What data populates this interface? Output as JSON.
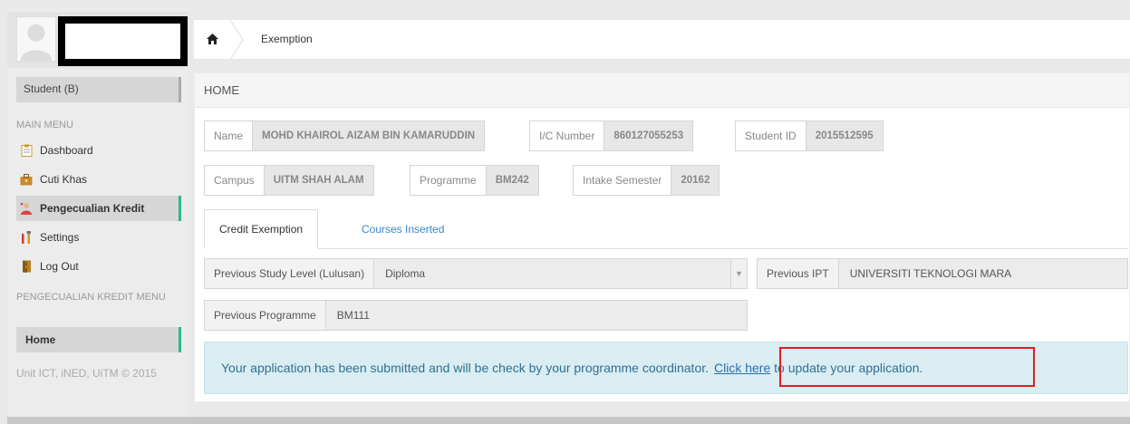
{
  "sidebar": {
    "role": "Student (B)",
    "main_menu_heading": "MAIN MENU",
    "items": [
      {
        "label": "Dashboard",
        "icon": "clipboard-icon"
      },
      {
        "label": "Cuti Khas",
        "icon": "briefcase-icon"
      },
      {
        "label": "Pengecualian Kredit",
        "icon": "person-icon"
      },
      {
        "label": "Settings",
        "icon": "tools-icon"
      },
      {
        "label": "Log Out",
        "icon": "door-icon"
      }
    ],
    "sub_menu_heading": "PENGECUALIAN KREDIT MENU",
    "sub_items": [
      {
        "label": "Home"
      }
    ],
    "footer": "Unit ICT, iNED, UiTM © 2015"
  },
  "breadcrumb": {
    "home_icon": "home-icon",
    "current": "Exemption"
  },
  "panel": {
    "title": "HOME",
    "info": {
      "name_label": "Name",
      "name_value": "MOHD KHAIROL AIZAM BIN KAMARUDDIN",
      "ic_label": "I/C Number",
      "ic_value": "860127055253",
      "student_id_label": "Student ID",
      "student_id_value": "2015512595",
      "campus_label": "Campus",
      "campus_value": "UITM SHAH ALAM",
      "programme_label": "Programme",
      "programme_value": "BM242",
      "intake_label": "Intake Semester",
      "intake_value": "20162"
    },
    "tabs": [
      {
        "label": "Credit Exemption",
        "active": true
      },
      {
        "label": "Courses Inserted",
        "active": false
      }
    ],
    "form": {
      "prev_level_label": "Previous Study Level (Lulusan)",
      "prev_level_value": "Diploma",
      "prev_ipt_label": "Previous IPT",
      "prev_ipt_value": "UNIVERSITI TEKNOLOGI MARA",
      "prev_programme_label": "Previous Programme",
      "prev_programme_value": "BM111"
    },
    "alert": {
      "message": "Your application has been submitted and will be check by your programme coordinator.",
      "link_text": "Click here",
      "suffix": " to update your application."
    }
  },
  "colors": {
    "active_border": "#2eb88a",
    "link": "#3a87c9",
    "alert_bg": "#d9edf3",
    "highlight": "#e21b22"
  }
}
